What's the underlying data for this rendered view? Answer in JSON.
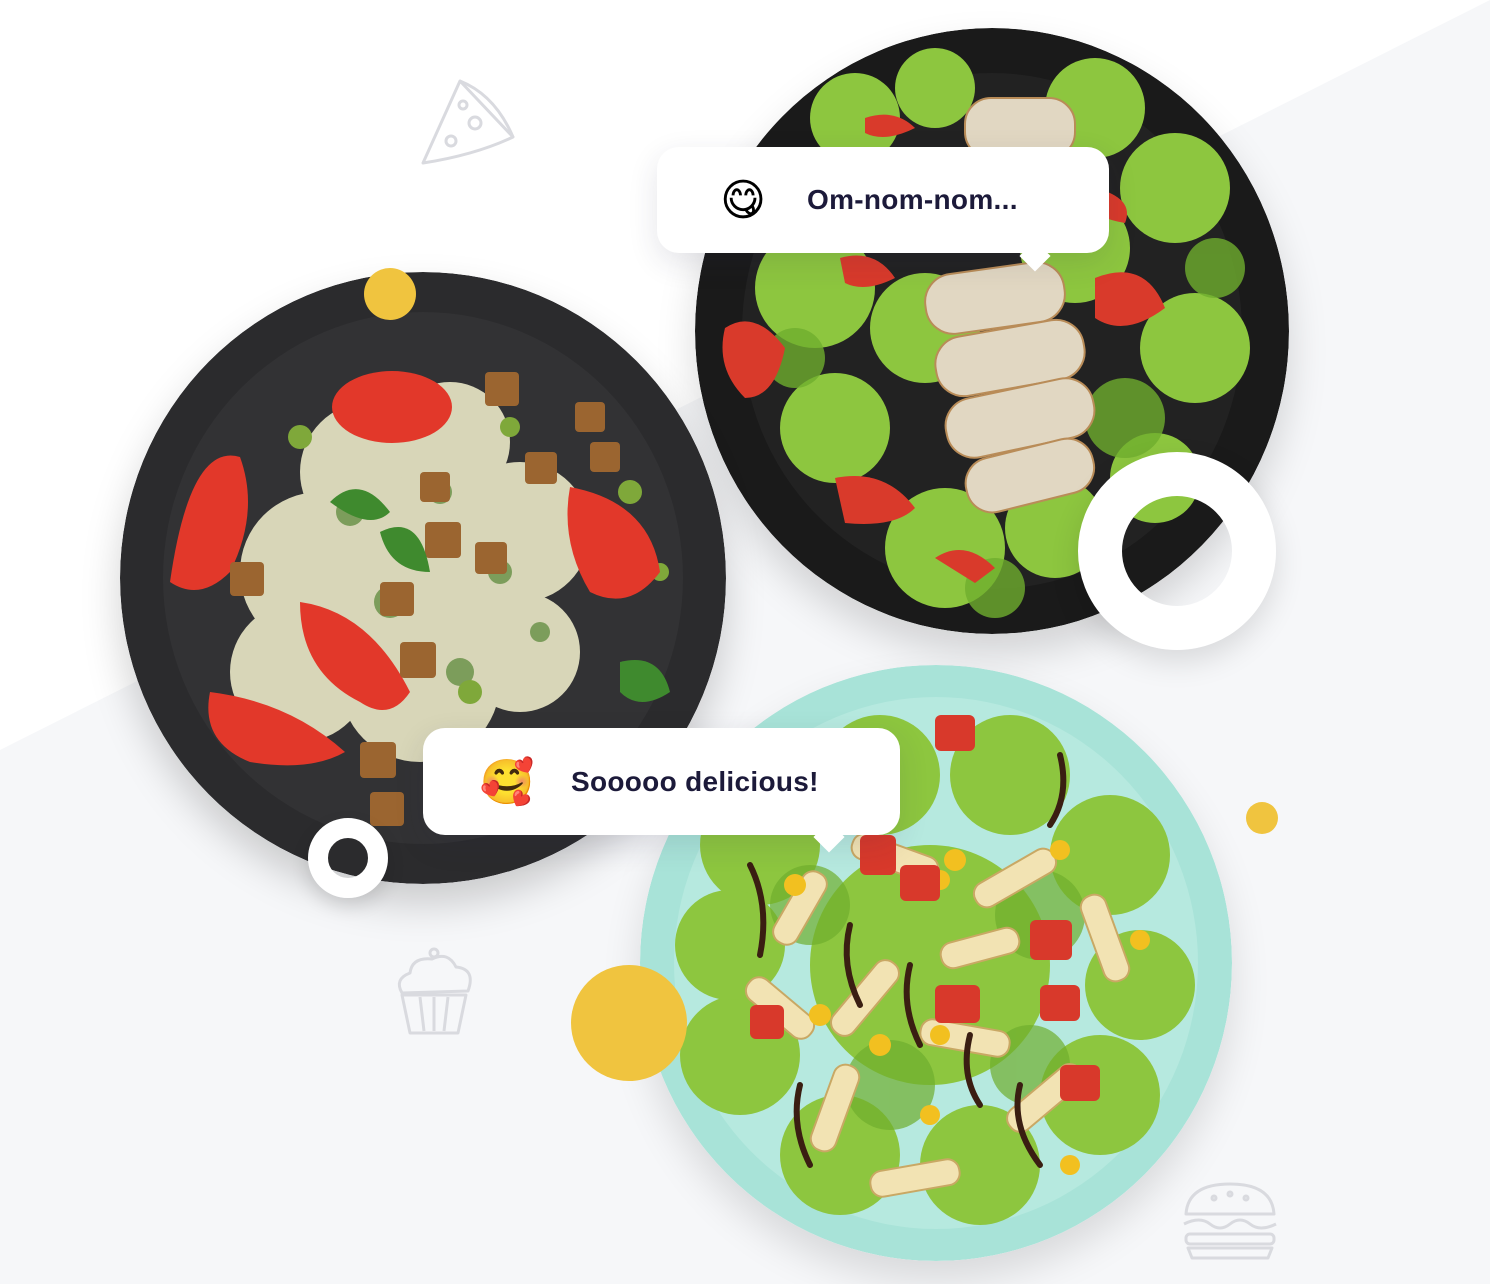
{
  "bubbles": {
    "top": {
      "emoji": "😋",
      "emoji_name": "yummy-face-icon",
      "text": "Om-nom-nom..."
    },
    "bottom": {
      "emoji": "🥰",
      "emoji_name": "smiling-face-with-hearts-icon",
      "text": "Sooooo delicious!"
    }
  },
  "colors": {
    "accent_yellow": "#F0C43F",
    "text_dark": "#1C1A3A",
    "plate_dark": "#2B2B2D",
    "plate_black": "#1A1A1A",
    "plate_mint": "#A8E3D8",
    "background_grey": "#F6F7F9"
  },
  "decorations": {
    "icons": [
      "pizza-slice-icon",
      "cupcake-icon",
      "burger-icon"
    ]
  }
}
